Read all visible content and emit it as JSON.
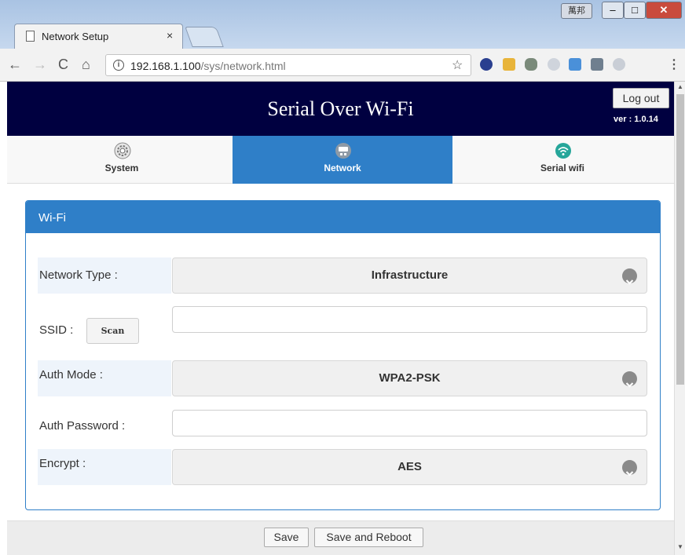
{
  "browser": {
    "tab_title": "Network Setup",
    "tab_close": "×",
    "url_host": "192.168.1.100",
    "url_path": "/sys/network.html",
    "ime_label": "萬邦",
    "nav": {
      "back": "←",
      "forward": "→",
      "reload": "C",
      "home": "⌂"
    },
    "star": "☆",
    "menu": "⋮"
  },
  "header": {
    "title": "Serial Over Wi-Fi",
    "logout_label": "Log out",
    "version": "ver : 1.0.14"
  },
  "tabs": [
    {
      "label": "System",
      "icon": "gear-icon"
    },
    {
      "label": "Network",
      "icon": "network-icon",
      "active": true
    },
    {
      "label": "Serial wifi",
      "icon": "wifi-icon"
    }
  ],
  "panel": {
    "title": "Wi-Fi",
    "network_type_label": "Network Type :",
    "network_type_value": "Infrastructure",
    "ssid_label": "SSID :",
    "scan_label": "Scan",
    "ssid_value": "",
    "auth_mode_label": "Auth Mode :",
    "auth_mode_value": "WPA2-PSK",
    "auth_password_label": "Auth Password :",
    "auth_password_value": "",
    "encrypt_label": "Encrypt :",
    "encrypt_value": "AES"
  },
  "footer": {
    "save_label": "Save",
    "save_reboot_label": "Save and Reboot"
  },
  "colors": {
    "banner": "#000040",
    "accent": "#2f7fc8"
  }
}
